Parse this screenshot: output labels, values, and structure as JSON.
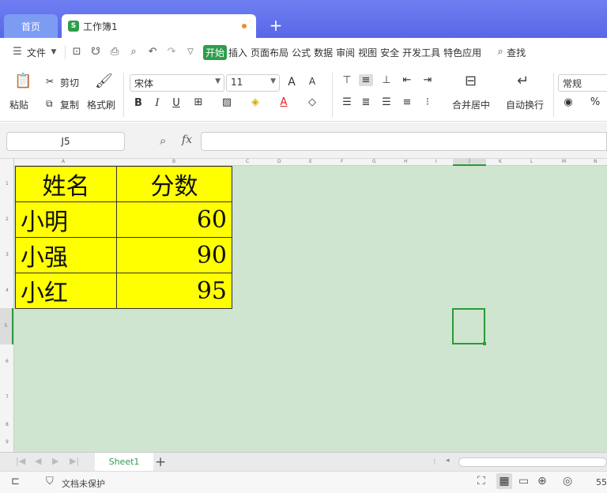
{
  "titlebar": {
    "home_tab": "首页",
    "doc_tab": "工作簿1",
    "doc_icon": "S",
    "new_tab": "+"
  },
  "menubar": {
    "file": "文件",
    "tabs": [
      "开始",
      "插入",
      "页面布局",
      "公式",
      "数据",
      "审阅",
      "视图",
      "安全",
      "开发工具",
      "特色应用"
    ],
    "search": "查找"
  },
  "ribbon": {
    "paste": "粘贴",
    "cut": "剪切",
    "copy": "复制",
    "format_painter": "格式刷",
    "font_name": "宋体",
    "font_size": "11",
    "bold": "B",
    "italic": "I",
    "underline": "U",
    "merge_center": "合并居中",
    "wrap_text": "自动换行",
    "number_format": "常规",
    "percent": "%"
  },
  "formulabar": {
    "cell_ref": "J5",
    "fx": "fx",
    "value": ""
  },
  "sheet": {
    "columns": [
      "A",
      "B",
      "C",
      "D",
      "E",
      "F",
      "G",
      "H",
      "I",
      "J",
      "K",
      "L",
      "M",
      "N"
    ],
    "rows": [
      "1",
      "2",
      "3",
      "4",
      "5",
      "6",
      "7",
      "8",
      "9"
    ],
    "table": {
      "headers": [
        "姓名",
        "分数"
      ],
      "rows": [
        {
          "name": "小明",
          "score": "60"
        },
        {
          "name": "小强",
          "score": "90"
        },
        {
          "name": "小红",
          "score": "95"
        }
      ]
    },
    "cell_fill": "#ffff00",
    "grid_bg": "#cfe5cf",
    "selection_color": "#2a9a3a"
  },
  "sheettabs": {
    "active": "Sheet1",
    "add": "+"
  },
  "statusbar": {
    "doc_status": "文档未保护",
    "zoom": "55"
  }
}
